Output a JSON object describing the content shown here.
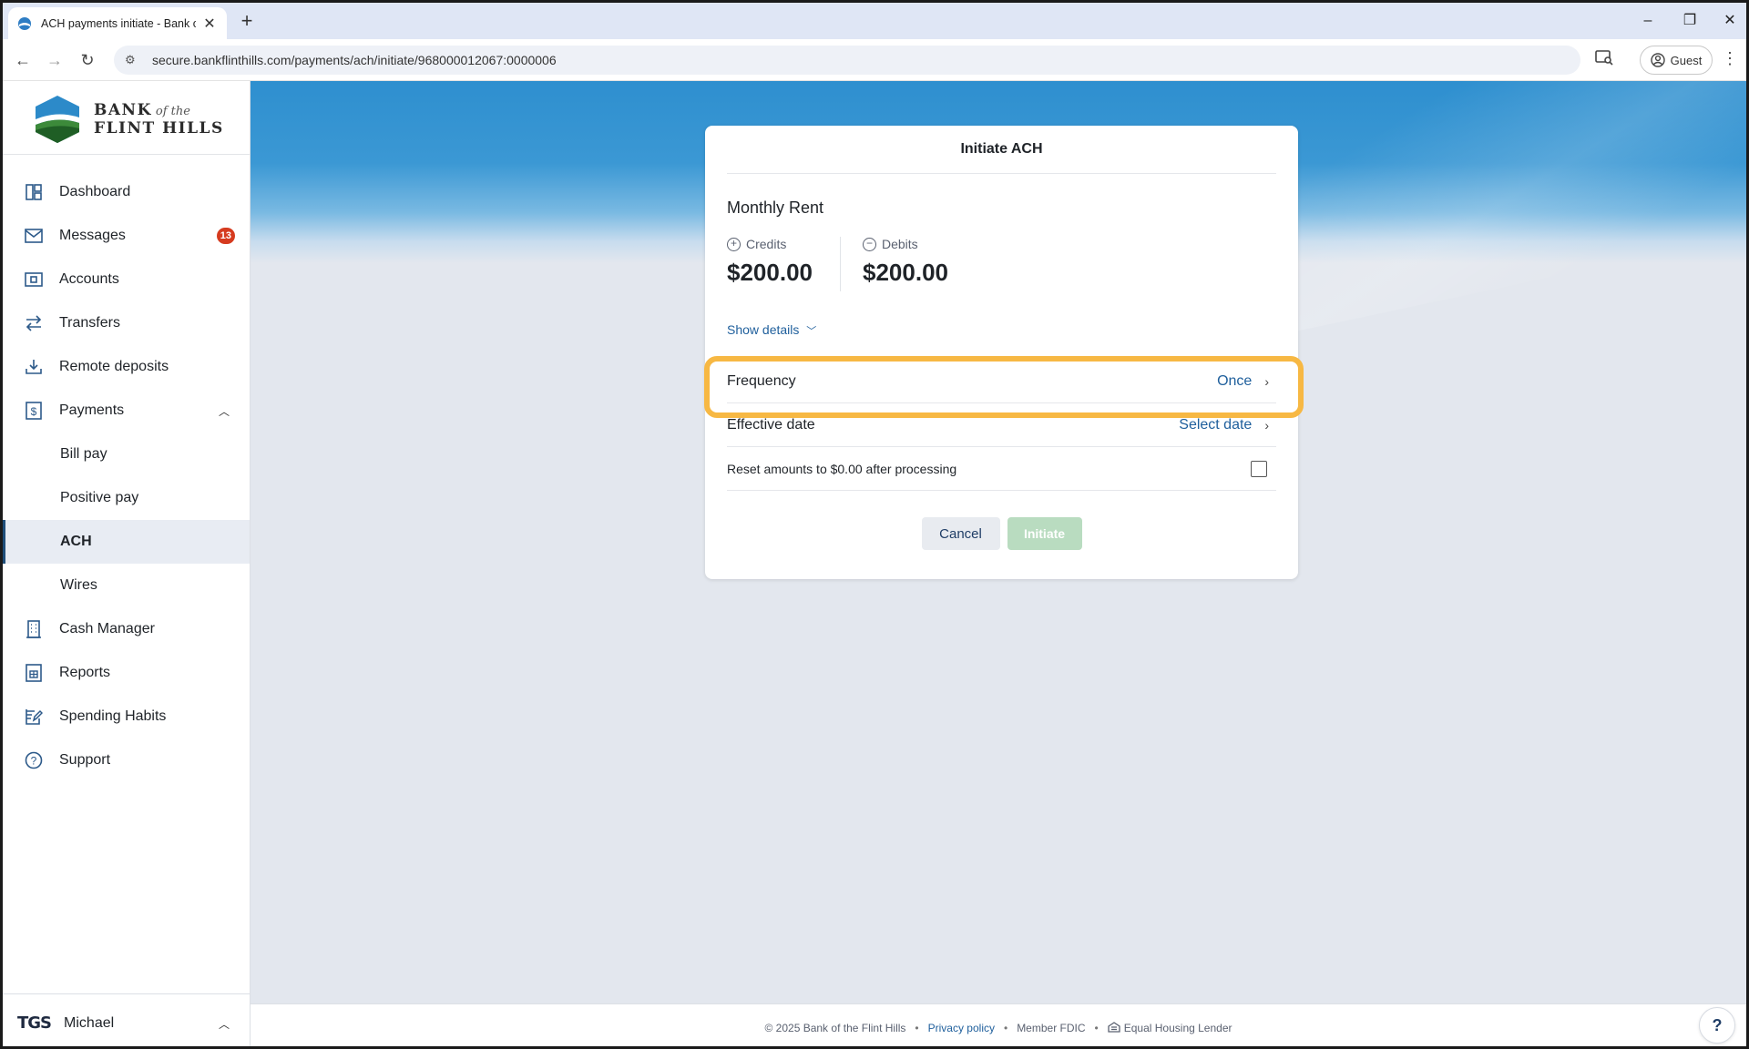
{
  "browser": {
    "tab_title": "ACH payments initiate - Bank of the Flint Hills",
    "url": "secure.bankflinthills.com/payments/ach/initiate/968000012067:0000006",
    "profile_label": "Guest"
  },
  "brand": {
    "line1": "BANK",
    "line1_small": "of the",
    "line2": "FLINT HILLS",
    "accent_color": "#1f5f9c"
  },
  "sidebar": {
    "items": [
      {
        "label": "Dashboard",
        "icon": "dashboard-icon"
      },
      {
        "label": "Messages",
        "icon": "mail-icon",
        "badge": "13"
      },
      {
        "label": "Accounts",
        "icon": "wallet-icon"
      },
      {
        "label": "Transfers",
        "icon": "transfer-icon"
      },
      {
        "label": "Remote deposits",
        "icon": "download-icon"
      },
      {
        "label": "Payments",
        "icon": "dollar-doc-icon",
        "expanded": true
      },
      {
        "label": "Bill pay",
        "sub": true
      },
      {
        "label": "Positive pay",
        "sub": true
      },
      {
        "label": "ACH",
        "sub": true,
        "active": true
      },
      {
        "label": "Wires",
        "sub": true
      },
      {
        "label": "Cash Manager",
        "icon": "building-icon"
      },
      {
        "label": "Reports",
        "icon": "report-icon"
      },
      {
        "label": "Spending Habits",
        "icon": "edit-icon"
      },
      {
        "label": "Support",
        "icon": "help-circle-icon"
      }
    ],
    "user": {
      "logo": "TGS",
      "name": "Michael"
    }
  },
  "card": {
    "title": "Initiate ACH",
    "template_name": "Monthly Rent",
    "credits_label": "Credits",
    "credits_value": "$200.00",
    "debits_label": "Debits",
    "debits_value": "$200.00",
    "show_details": "Show details",
    "frequency_label": "Frequency",
    "frequency_value": "Once",
    "effective_date_label": "Effective date",
    "effective_date_value": "Select date",
    "reset_label": "Reset amounts to $0.00 after processing",
    "reset_checked": false,
    "cancel_label": "Cancel",
    "initiate_label": "Initiate"
  },
  "footer": {
    "copyright": "© 2025 Bank of the Flint Hills",
    "privacy": "Privacy policy",
    "fdic": "Member FDIC",
    "housing": "Equal Housing Lender"
  },
  "help_label": "?"
}
